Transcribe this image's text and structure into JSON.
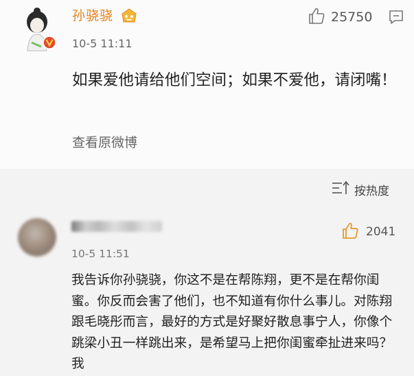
{
  "post": {
    "author": "孙骁骁",
    "likes": "25750",
    "time": "10-5 11:11",
    "text": "如果爱他请给他们空间；如果不爱他，请闭嘴！",
    "view_original": "查看原微博"
  },
  "sort": {
    "label": "按热度"
  },
  "comment": {
    "likes": "2041",
    "time": "10-5 11:51",
    "text": "我告诉你孙骁骁，你这不是在帮陈翔，更不是在帮你闺蜜。你反而会害了他们，也不知道有你什么事儿。对陈翔跟毛晓彤而言，最好的方式是好聚好散息事宁人，你像个跳梁小丑一样跳出来，是希望马上把你闺蜜牵扯进来吗？我"
  },
  "colors": {
    "author_name": "#e4811f",
    "like_icon_comment": "#e39a2e",
    "badge": "#e24b2c"
  },
  "icons": [
    "avatar",
    "vip-badge",
    "thumbs-up-icon",
    "comment-icon",
    "sort-icon",
    "verified-badge"
  ]
}
